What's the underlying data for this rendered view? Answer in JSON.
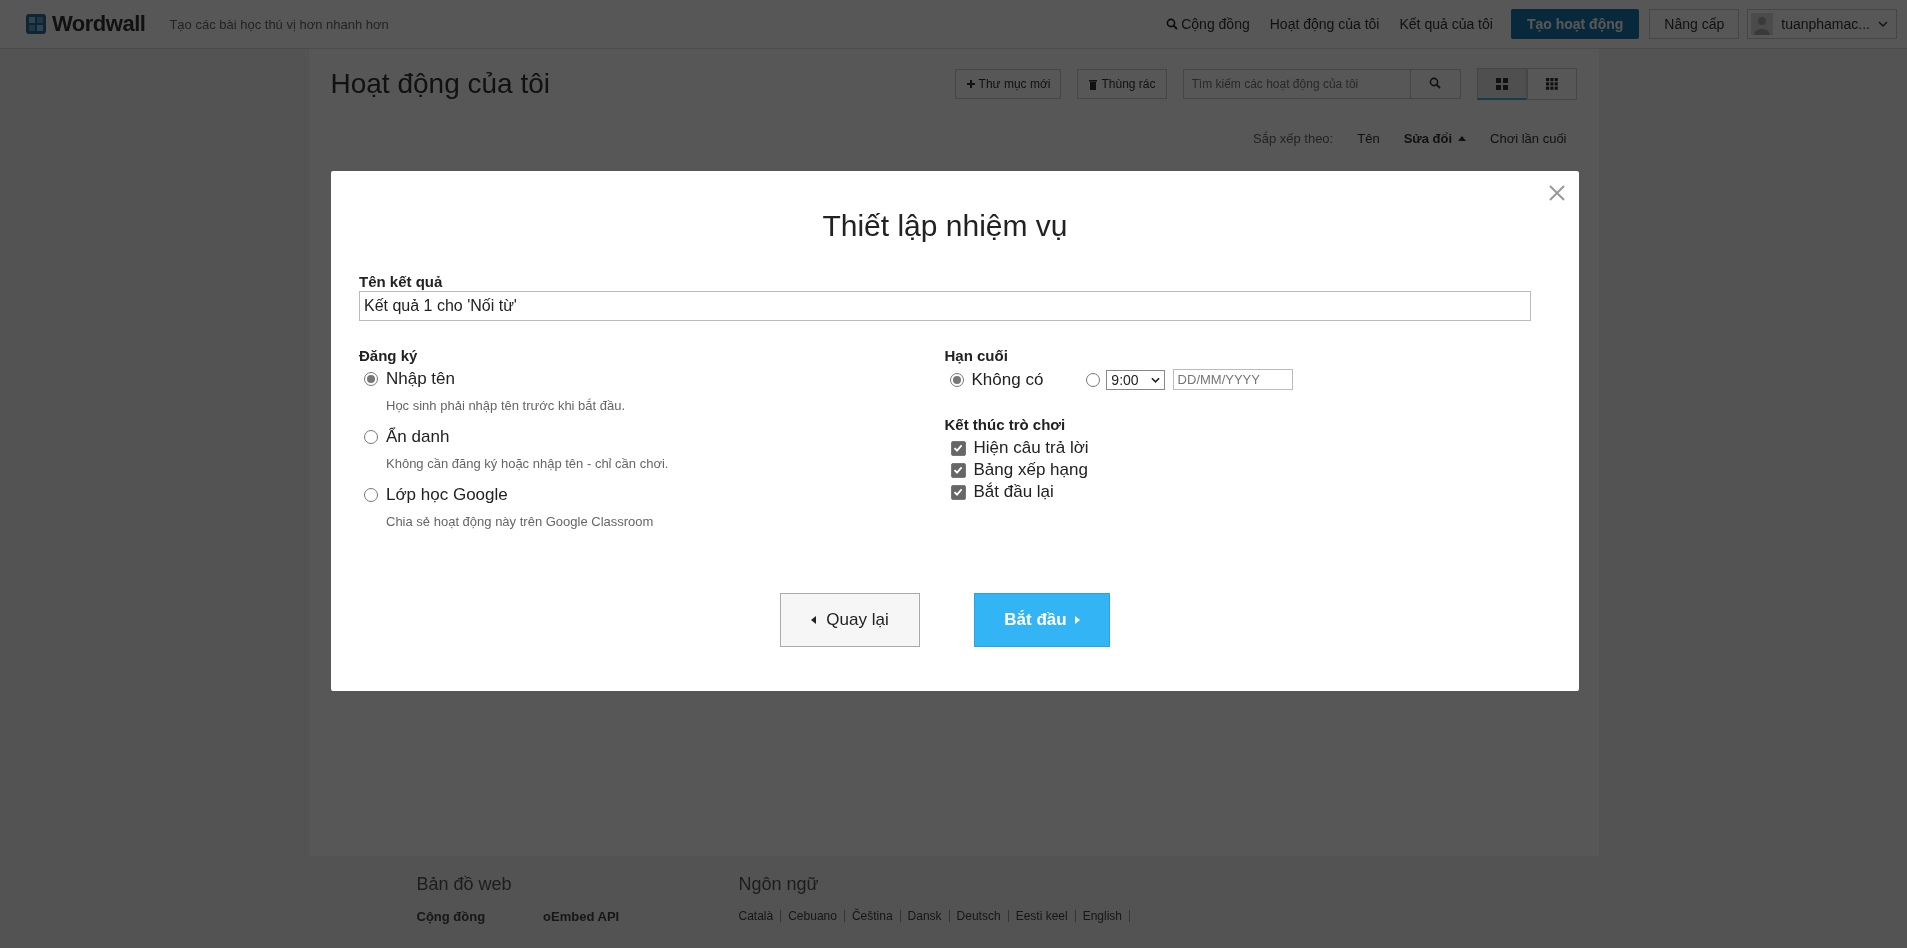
{
  "top_bar": {
    "logo": "Wordwall",
    "tagline": "Tạo các bài học thú vị hơn nhanh hơn",
    "nav": [
      {
        "label": "Cộng đồng",
        "kind": "search"
      },
      {
        "label": "Hoạt động của tôi",
        "kind": "link"
      },
      {
        "label": "Kết quả của tôi",
        "kind": "link"
      }
    ],
    "create_button": "Tạo hoạt động",
    "upgrade_button": "Nâng cấp",
    "user": "tuanphamac..."
  },
  "page": {
    "title": "Hoạt động của tôi",
    "new_folder_button": "Thư mục mới",
    "trash_button": "Thùng rác",
    "search": {
      "placeholder": "Tìm kiếm các hoạt động của tôi"
    },
    "views": [
      {
        "kind": "grid",
        "selected": true
      },
      {
        "kind": "list",
        "selected": false
      }
    ],
    "sort": {
      "label": "Sắp xếp theo:",
      "options": [
        {
          "label": "Tên",
          "selected": false
        },
        {
          "label": "Sửa đổi",
          "selected": true
        },
        {
          "label": "Chơi lần cuối",
          "selected": false
        }
      ]
    }
  },
  "footer": {
    "sitemap_title": "Bản đồ web",
    "sitemap_links": [
      "Cộng đồng",
      "oEmbed API"
    ],
    "language_title": "Ngôn ngữ",
    "languages": [
      "Català",
      "Cebuano",
      "Čeština",
      "Dansk",
      "Deutsch",
      "Eesti keel",
      "English"
    ]
  },
  "dialog": {
    "title": "Thiết lập nhiệm vụ",
    "result_name": {
      "label": "Tên kết quả",
      "value": "Kết quả 1 cho 'Nối từ'"
    },
    "registration": {
      "label": "Đăng ký",
      "options": [
        {
          "label": "Nhập tên",
          "hint": "Học sinh phải nhập tên trước khi bắt đầu.",
          "selected": true
        },
        {
          "label": "Ẩn danh",
          "hint": "Không cần đăng ký hoặc nhập tên - chỉ cần chơi.",
          "selected": false
        },
        {
          "label": "Lớp học Google",
          "hint": "Chia sẻ hoạt động này trên Google Classroom",
          "selected": false
        }
      ]
    },
    "deadline": {
      "label": "Hạn cuối",
      "options": [
        {
          "kind": "none",
          "label": "Không có",
          "selected": true
        },
        {
          "kind": "date",
          "time": "9:00",
          "date_placeholder": "DD/MM/YYYY",
          "selected": false
        }
      ]
    },
    "game_end": {
      "label": "Kết thúc trò chơi",
      "options": [
        {
          "label": "Hiện câu trả lời",
          "checked": true
        },
        {
          "label": "Bảng xếp hạng",
          "checked": true
        },
        {
          "label": "Bắt đầu lại",
          "checked": true
        }
      ]
    },
    "back_button": "Quay lại",
    "start_button": "Bắt đầu"
  }
}
